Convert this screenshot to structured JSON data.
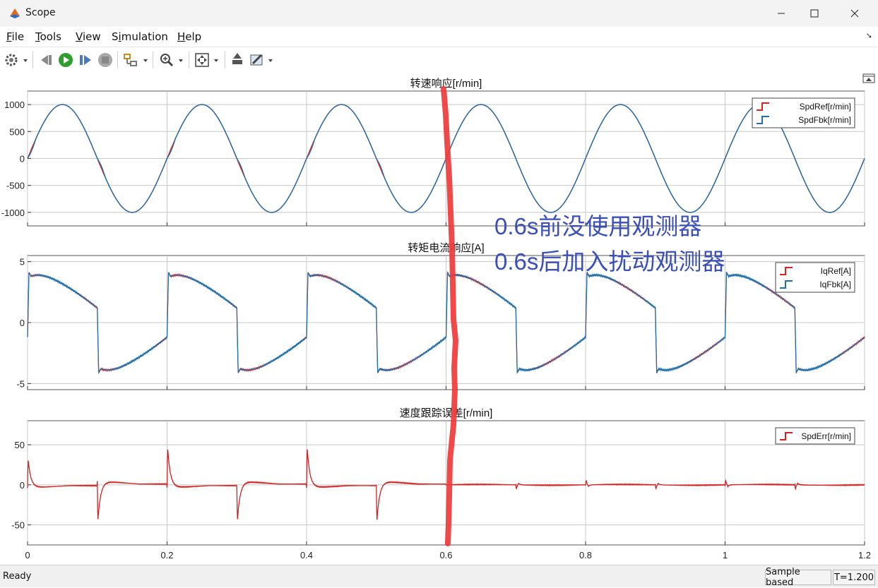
{
  "window": {
    "title": "Scope"
  },
  "menu": [
    {
      "pre": "",
      "u": "F",
      "post": "ile"
    },
    {
      "pre": "",
      "u": "T",
      "post": "ools"
    },
    {
      "pre": "",
      "u": "V",
      "post": "iew"
    },
    {
      "pre": "S",
      "u": "i",
      "post": "mulation"
    },
    {
      "pre": "",
      "u": "H",
      "post": "elp"
    }
  ],
  "toolbar_icons": [
    "settings-icon",
    "step-back-icon",
    "run-icon",
    "step-forward-icon",
    "stop-icon",
    "highlight-block-icon",
    "zoom-icon",
    "fit-icon",
    "cursor-measure-icon",
    "style-icon"
  ],
  "status": {
    "ready": "Ready",
    "mode": "Sample based",
    "time": "T=1.200"
  },
  "annotation": {
    "line1": "0.6s前没使用观测器",
    "line2": "0.6s后加入扰动观测器",
    "color": "#3b4fb8",
    "marker_color": "#ee3a3a"
  },
  "colors": {
    "ref": "#e02020",
    "fbk": "#1f6fa8",
    "err": "#d42020"
  },
  "chart_data": [
    {
      "type": "line",
      "title": "转速响应[r/min]",
      "xlim": [
        0,
        1.2
      ],
      "ylim": [
        -1250,
        1250
      ],
      "yticks": [
        -1000,
        -500,
        0,
        500,
        1000
      ],
      "ytick_labels": [
        "-1000",
        "-500",
        "0",
        "500",
        "1000"
      ],
      "xticks": [
        0,
        0.2,
        0.4,
        0.6,
        0.8,
        1.0,
        1.2
      ],
      "grid": true,
      "legend": "top-right",
      "series": [
        {
          "name": "SpdRef[r/min]",
          "waveform": "sine",
          "amplitude": 1000,
          "frequency": 5
        },
        {
          "name": "SpdFbk[r/min]",
          "waveform": "sine-lagging",
          "amplitude": 1000,
          "frequency": 5
        }
      ]
    },
    {
      "type": "line",
      "title": "转矩电流响应[A]",
      "xlim": [
        0,
        1.2
      ],
      "ylim": [
        -5.5,
        5.5
      ],
      "yticks": [
        -5,
        0,
        5
      ],
      "ytick_labels": [
        "-5",
        "0",
        "5"
      ],
      "xticks": [
        0,
        0.2,
        0.4,
        0.6,
        0.8,
        1.0,
        1.2
      ],
      "grid": true,
      "legend": "top-right",
      "series": [
        {
          "name": "IqRef[A]",
          "period": 0.2,
          "step_peak": 4.1,
          "plateau": 3.8,
          "fall_to": 1.2
        },
        {
          "name": "IqFbk[A]",
          "period": 0.2,
          "step_peak": 4.1,
          "plateau": 3.8,
          "fall_to": 1.2
        }
      ]
    },
    {
      "type": "line",
      "title": "速度跟踪误差[r/min]",
      "xlim": [
        0,
        1.2
      ],
      "ylim": [
        -75,
        80
      ],
      "yticks": [
        -50,
        0,
        50
      ],
      "ytick_labels": [
        "-50",
        "0",
        "50"
      ],
      "xticks": [
        0,
        0.2,
        0.4,
        0.6,
        0.8,
        1.0,
        1.2
      ],
      "xtick_labels": [
        "0",
        "0.2",
        "0.4",
        "0.6",
        "0.8",
        "1",
        "1.2"
      ],
      "grid": true,
      "legend": "top-right",
      "series": [
        {
          "name": "SpdErr[r/min]",
          "spikes_before_0_6": [
            [
              0.0,
              44
            ],
            [
              0.1,
              -62
            ],
            [
              0.2,
              62
            ],
            [
              0.3,
              -62
            ],
            [
              0.4,
              62
            ],
            [
              0.5,
              -62
            ]
          ],
          "spikes_after_0_6": [
            [
              0.7,
              -10
            ],
            [
              0.8,
              11
            ],
            [
              0.9,
              -10
            ],
            [
              1.0,
              11
            ],
            [
              1.1,
              -10
            ]
          ]
        }
      ]
    }
  ]
}
